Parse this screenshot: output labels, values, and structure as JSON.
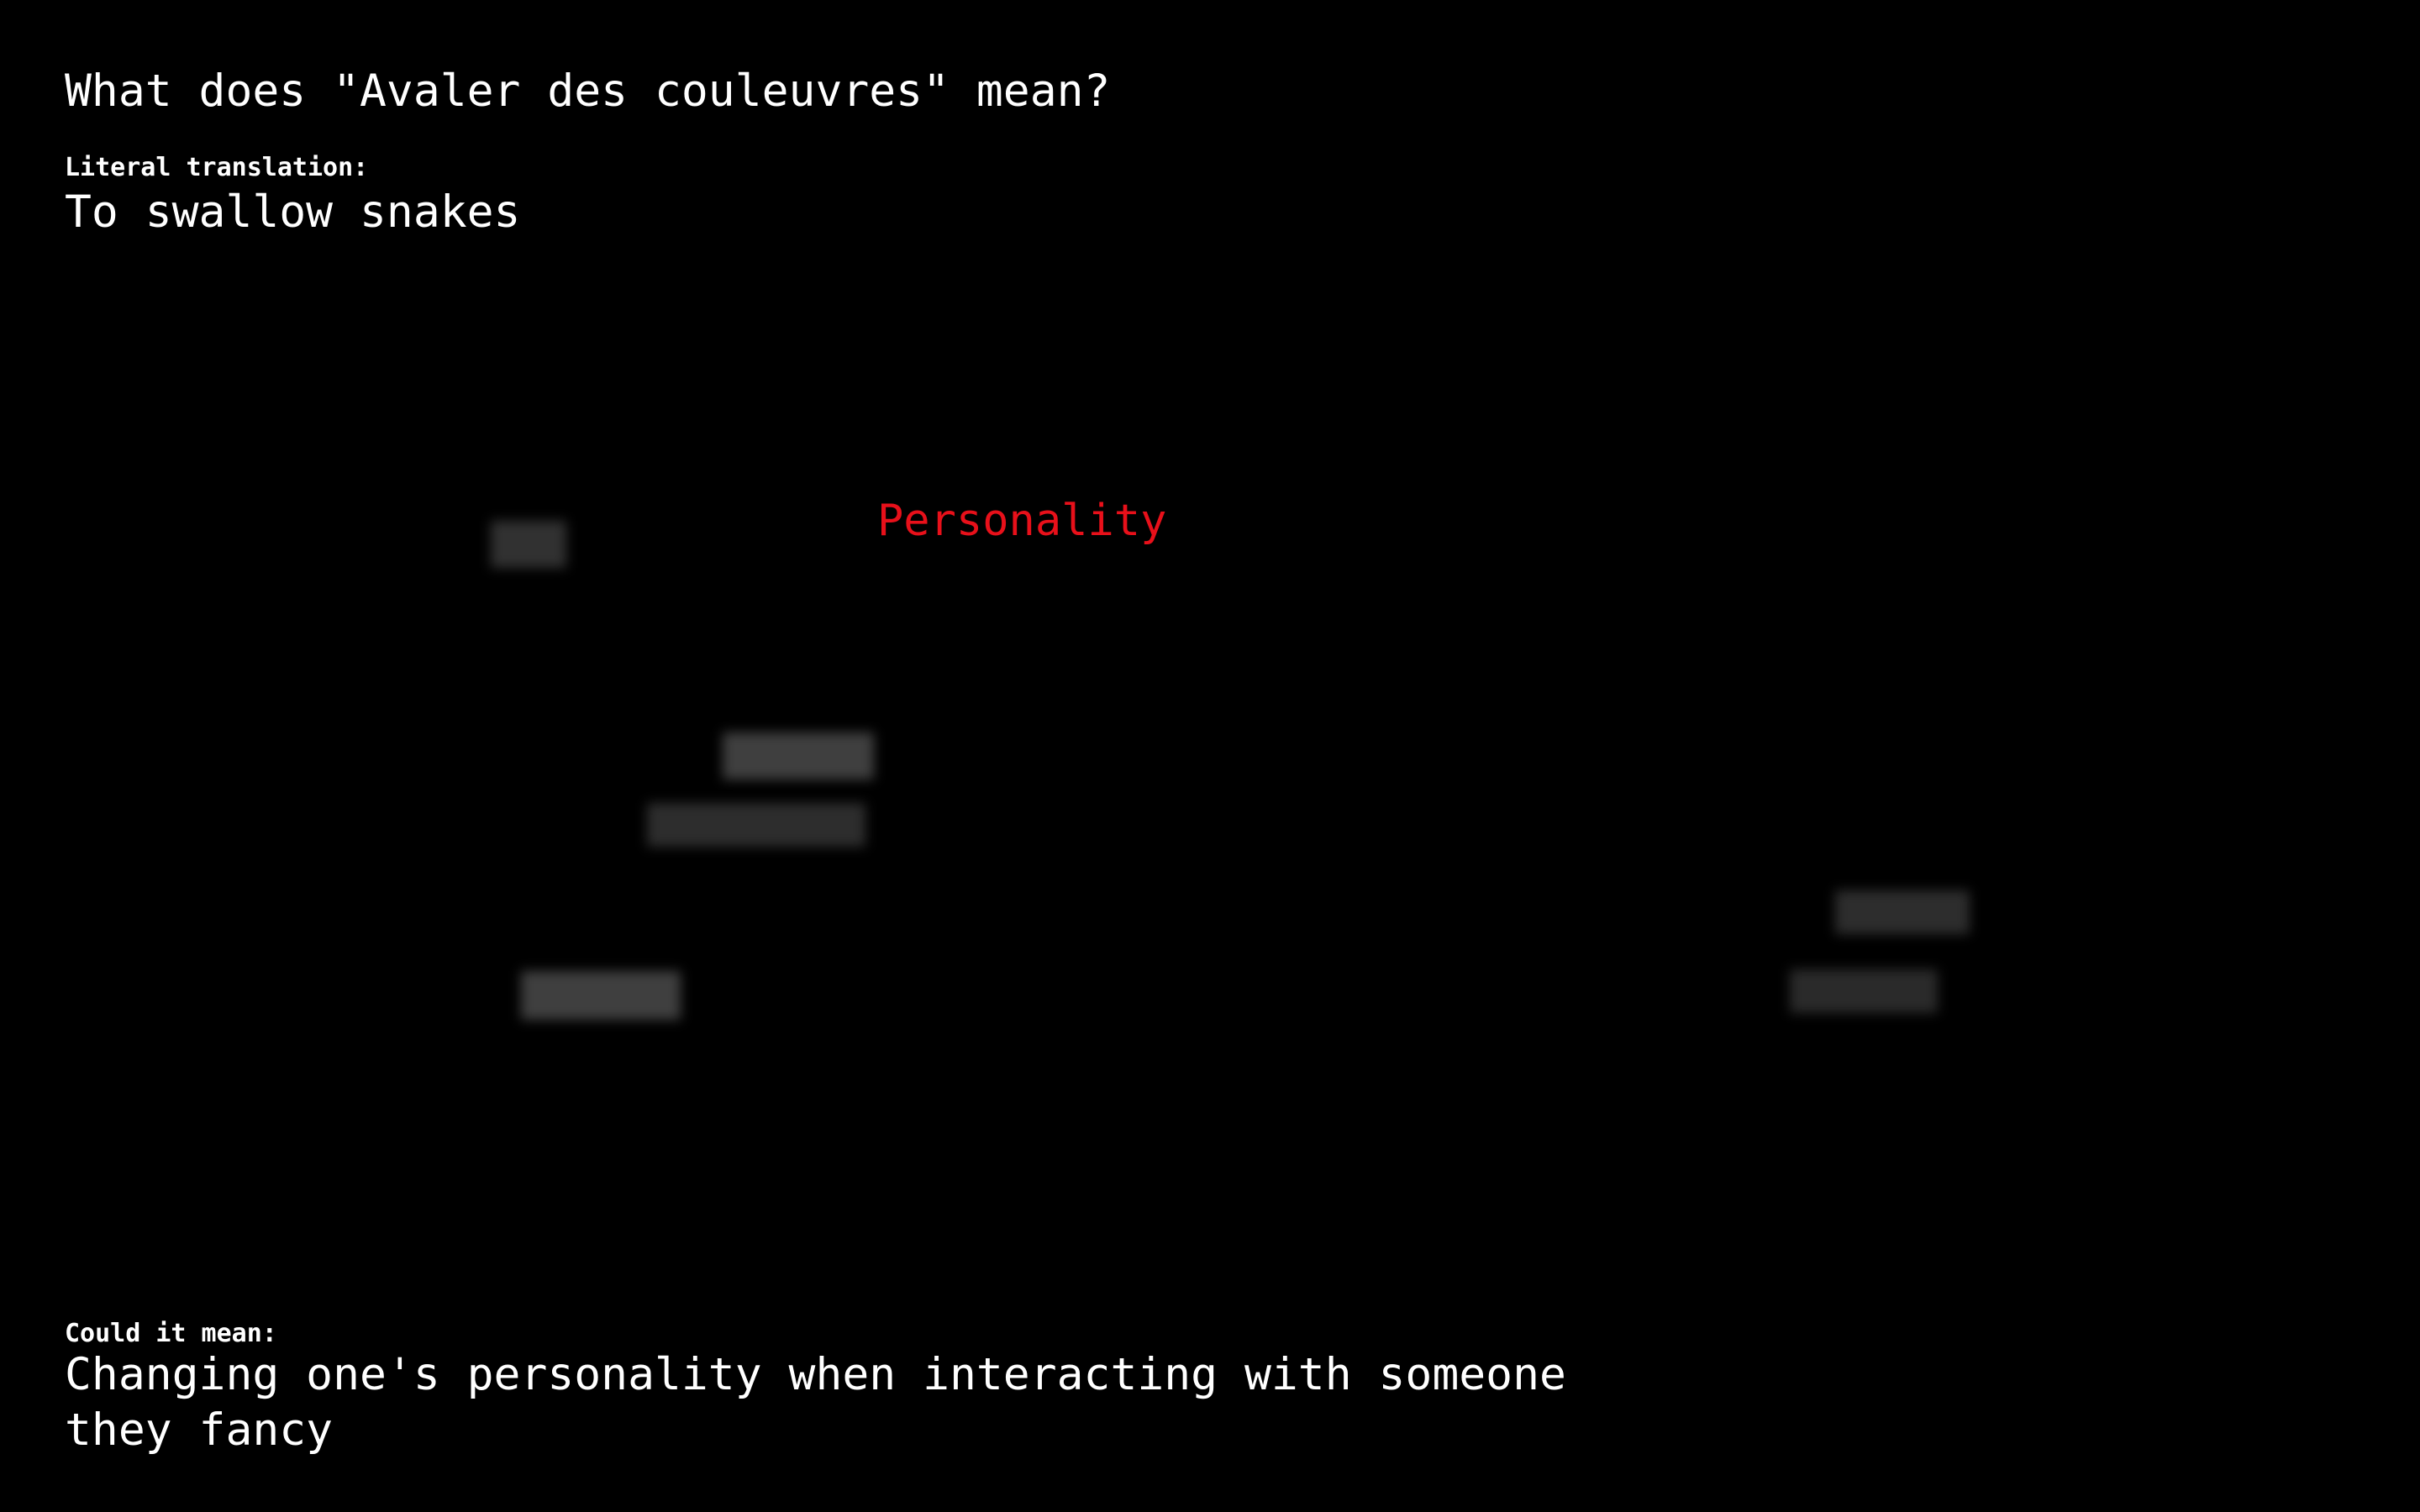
{
  "question": "What does \"Avaler des couleuvres\" mean?",
  "literal": {
    "label": "Literal translation:",
    "value": "To swallow snakes"
  },
  "word_cloud": {
    "focus_word": "Personality",
    "focus_color": "#e8101a",
    "blurred_color": "#8a8a8a"
  },
  "meaning": {
    "label": "Could it mean:",
    "value": "Changing one's personality when interacting with someone they fancy"
  },
  "colors": {
    "background": "#000000",
    "text": "#ffffff"
  }
}
